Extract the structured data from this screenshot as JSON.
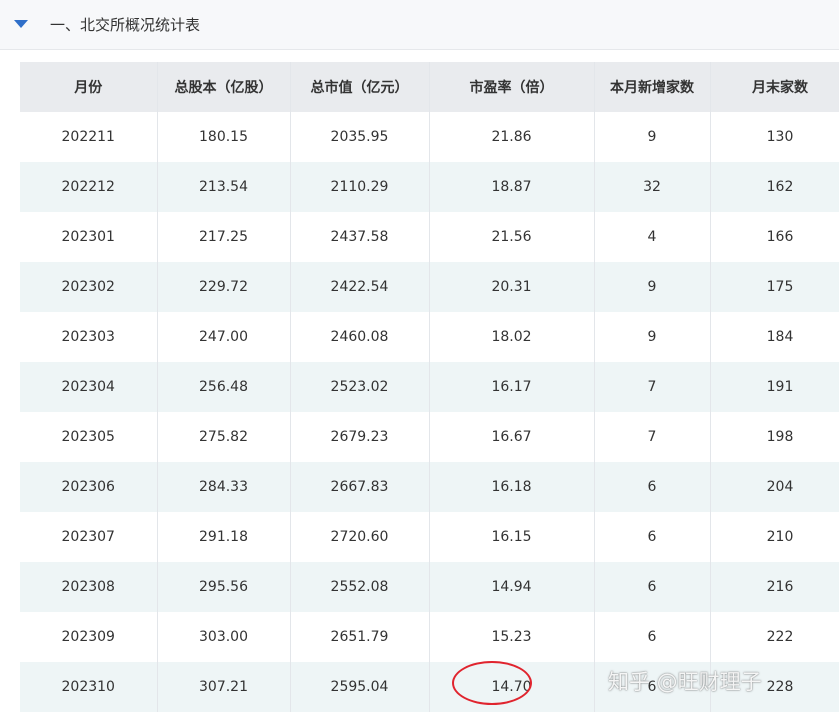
{
  "section": {
    "title": "一、北交所概况统计表"
  },
  "table": {
    "headers": [
      "月份",
      "总股本（亿股）",
      "总市值（亿元）",
      "市盈率（倍）",
      "本月新增家数",
      "月末家数"
    ],
    "rows": [
      [
        "202211",
        "180.15",
        "2035.95",
        "21.86",
        "9",
        "130"
      ],
      [
        "202212",
        "213.54",
        "2110.29",
        "18.87",
        "32",
        "162"
      ],
      [
        "202301",
        "217.25",
        "2437.58",
        "21.56",
        "4",
        "166"
      ],
      [
        "202302",
        "229.72",
        "2422.54",
        "20.31",
        "9",
        "175"
      ],
      [
        "202303",
        "247.00",
        "2460.08",
        "18.02",
        "9",
        "184"
      ],
      [
        "202304",
        "256.48",
        "2523.02",
        "16.17",
        "7",
        "191"
      ],
      [
        "202305",
        "275.82",
        "2679.23",
        "16.67",
        "7",
        "198"
      ],
      [
        "202306",
        "284.33",
        "2667.83",
        "16.18",
        "6",
        "204"
      ],
      [
        "202307",
        "291.18",
        "2720.60",
        "16.15",
        "6",
        "210"
      ],
      [
        "202308",
        "295.56",
        "2552.08",
        "14.94",
        "6",
        "216"
      ],
      [
        "202309",
        "303.00",
        "2651.79",
        "15.23",
        "6",
        "222"
      ],
      [
        "202310",
        "307.21",
        "2595.04",
        "14.70",
        "6",
        "228"
      ]
    ]
  },
  "watermark": {
    "text": "知乎 @旺财理子"
  },
  "colors": {
    "caret": "#2f6fc9",
    "highlight_ring": "#e0242e",
    "header_bg": "#e9ebee",
    "stripe_bg": "#eef5f6"
  }
}
